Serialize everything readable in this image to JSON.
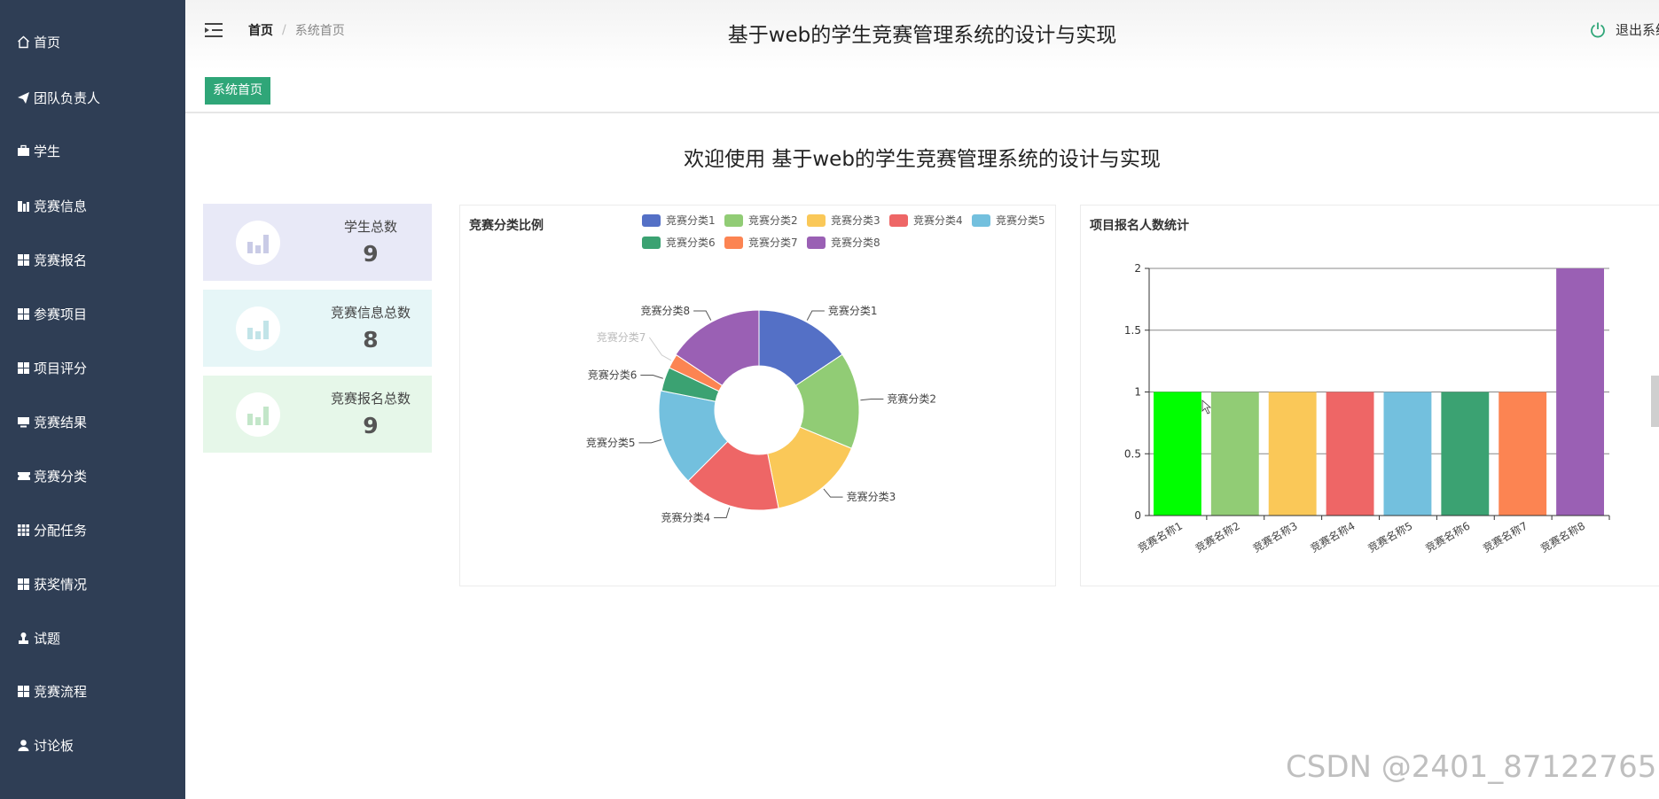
{
  "sidebar": {
    "items": [
      {
        "label": "首页",
        "icon": "home-icon"
      },
      {
        "label": "团队负责人",
        "icon": "paper-plane-icon"
      },
      {
        "label": "学生",
        "icon": "briefcase-icon"
      },
      {
        "label": "竞赛信息",
        "icon": "building-icon"
      },
      {
        "label": "竞赛报名",
        "icon": "grid-icon"
      },
      {
        "label": "参赛项目",
        "icon": "grid-icon"
      },
      {
        "label": "项目评分",
        "icon": "grid-icon"
      },
      {
        "label": "竞赛结果",
        "icon": "monitor-icon"
      },
      {
        "label": "竞赛分类",
        "icon": "ticket-icon"
      },
      {
        "label": "分配任务",
        "icon": "apps-icon"
      },
      {
        "label": "获奖情况",
        "icon": "grid-icon"
      },
      {
        "label": "试题",
        "icon": "stamp-icon"
      },
      {
        "label": "竞赛流程",
        "icon": "grid-icon"
      },
      {
        "label": "讨论板",
        "icon": "user-icon"
      }
    ]
  },
  "header": {
    "breadcrumb": {
      "home": "首页",
      "separator": "/",
      "current": "系统首页"
    },
    "title": "基于web的学生竞赛管理系统的设计与实现",
    "logout_label": "退出系统"
  },
  "tabs": {
    "active": "系统首页"
  },
  "welcome": "欢迎使用 基于web的学生竞赛管理系统的设计与实现",
  "stats": [
    {
      "label": "学生总数",
      "value": "9",
      "bg": "#e8e9f7",
      "icon_color": "#c9cbe6"
    },
    {
      "label": "竞赛信息总数",
      "value": "8",
      "bg": "#e6f6f7",
      "icon_color": "#c2e4e8"
    },
    {
      "label": "竞赛报名总数",
      "value": "9",
      "bg": "#e6f7e9",
      "icon_color": "#c3e6c9"
    }
  ],
  "pie_panel": {
    "title": "竞赛分类比例"
  },
  "bar_panel": {
    "title": "项目报名人数统计"
  },
  "chart_data": [
    {
      "type": "pie",
      "title": "竞赛分类比例",
      "categories": [
        "竞赛分类1",
        "竞赛分类2",
        "竞赛分类3",
        "竞赛分类4",
        "竞赛分类5",
        "竞赛分类6",
        "竞赛分类7",
        "竞赛分类8"
      ],
      "values": [
        1,
        1,
        1,
        1,
        1,
        0.25,
        0.15,
        1
      ],
      "colors": [
        "#5470c6",
        "#91cc75",
        "#fac858",
        "#ee6666",
        "#73c0de",
        "#3ba272",
        "#fc8452",
        "#9a60b4"
      ],
      "legend_position": "top-right",
      "donut": true
    },
    {
      "type": "bar",
      "title": "项目报名人数统计",
      "categories": [
        "竞赛名称1",
        "竞赛名称2",
        "竞赛名称3",
        "竞赛名称4",
        "竞赛名称5",
        "竞赛名称6",
        "竞赛名称7",
        "竞赛名称8"
      ],
      "values": [
        1,
        1,
        1,
        1,
        1,
        1,
        1,
        2
      ],
      "colors": [
        "#00ff00",
        "#91cc75",
        "#fac858",
        "#ee6666",
        "#73c0de",
        "#3ba272",
        "#fc8452",
        "#9a60b4"
      ],
      "ylim": [
        0,
        2
      ],
      "yticks": [
        "0",
        "0.5",
        "1",
        "1.5",
        "2"
      ],
      "grid": true
    }
  ],
  "watermark": "CSDN @2401_87122765"
}
